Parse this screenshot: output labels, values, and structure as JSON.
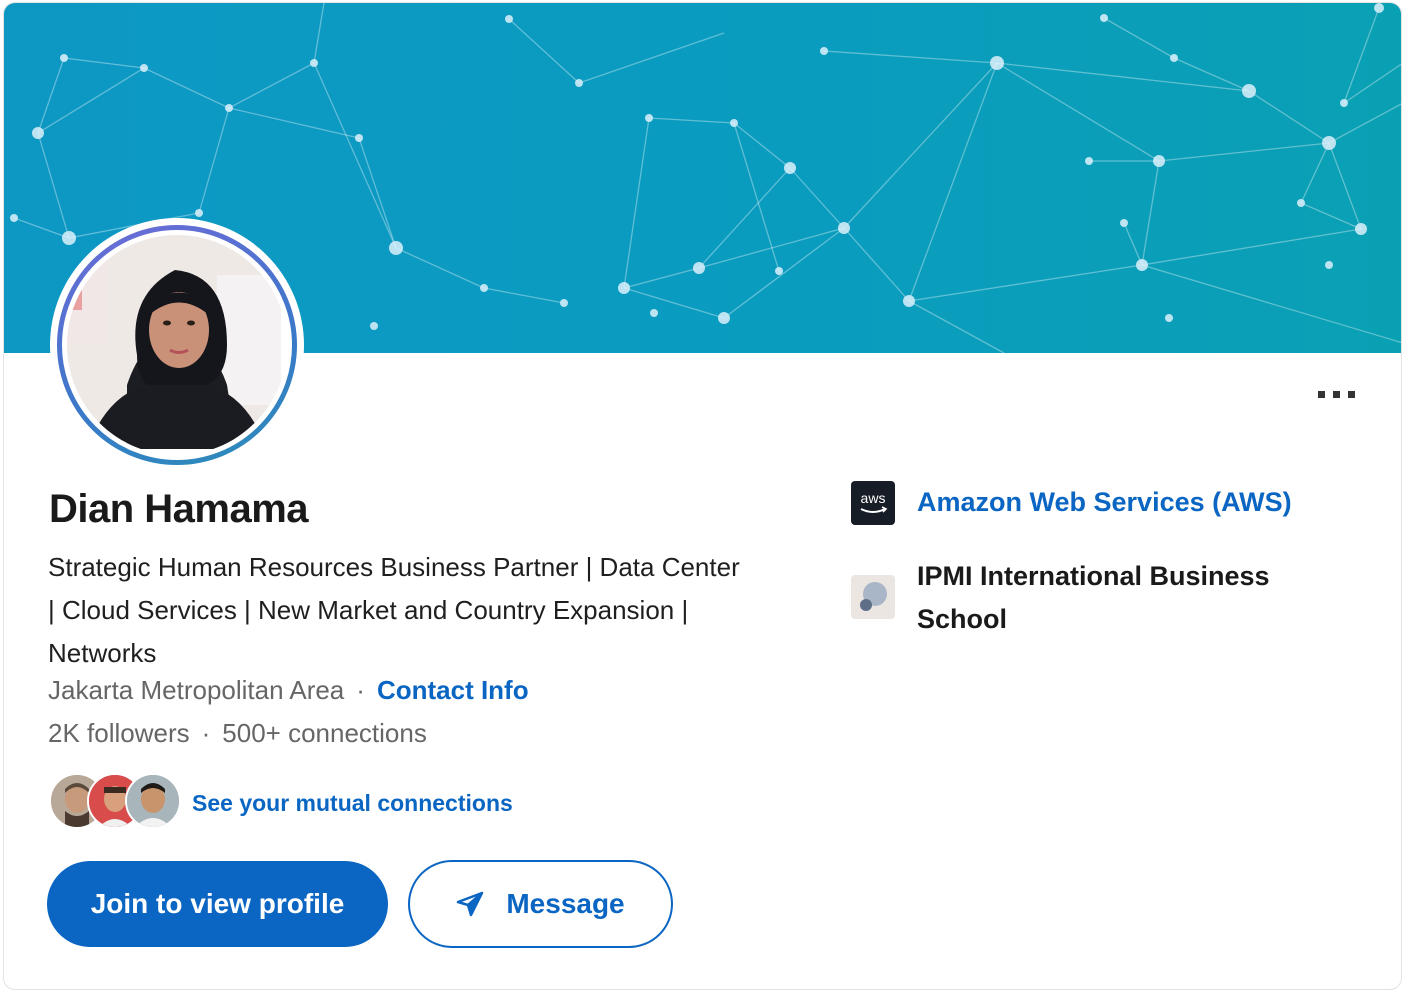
{
  "profile": {
    "name": "Dian Hamama",
    "headline": "Strategic Human Resources Business Partner | Data Center | Cloud Services | New Market and Country Expansion | Networks",
    "location": "Jakarta Metropolitan Area",
    "contact_info_label": "Contact Info",
    "followers": "2K followers",
    "connections": "500+ connections",
    "separator": "·",
    "mutual_connections_label": "See your mutual connections"
  },
  "actions": {
    "join_label": "Join to view profile",
    "message_label": "Message",
    "more_label": "..."
  },
  "experience": [
    {
      "name": "Amazon Web Services (AWS)",
      "logo_text": "aws",
      "icon": "aws-logo-icon"
    },
    {
      "name": "IPMI International Business School",
      "icon": "ipmi-logo-icon"
    }
  ],
  "colors": {
    "accent": "#0a66c2",
    "banner": "#0d98c4"
  }
}
